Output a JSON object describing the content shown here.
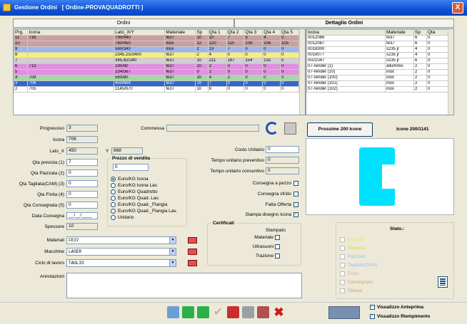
{
  "window": {
    "title": "Gestione Ordini",
    "subtitle": "[ Ordine-PROVAQUADROTTI ]",
    "close_glyph": "X"
  },
  "tabs": {
    "left": "Ordini",
    "right": "Dettaglio Ordini"
  },
  "left_table": {
    "headers": [
      "Prg.",
      "Icona",
      "Lato_X/Y",
      "Materiale",
      "Sp",
      "Qta 1",
      "Qta 2",
      "Qta 3",
      "Qta 4",
      "Qta 5"
    ],
    "rows": [
      {
        "bg": "#c9a0a0",
        "cells": [
          "11",
          "716",
          "790/440",
          "fe37",
          "10",
          "10",
          "7",
          "5",
          "4",
          "0"
        ]
      },
      {
        "bg": "#c9a0a0",
        "cells": [
          "10",
          "",
          "780/450",
          "inox",
          "12",
          "120",
          "110",
          "108",
          "106",
          "105"
        ]
      },
      {
        "bg": "#9db5ee",
        "cells": [
          "9",
          "",
          "560/340",
          "inox",
          "2",
          "13",
          "7",
          "0",
          "0",
          "0"
        ]
      },
      {
        "bg": "#f5f07c",
        "cells": [
          "8",
          "",
          "2345.25/3400",
          "fe37",
          "2",
          "4",
          "0",
          "0",
          "0",
          "0"
        ]
      },
      {
        "bg": "#d0d0d0",
        "cells": [
          "7",
          "",
          "345.82/240",
          "fe37",
          "10",
          "211",
          "187",
          "154",
          "132",
          "0"
        ]
      },
      {
        "bg": "#df90df",
        "cells": [
          "6",
          "713",
          "190/80",
          "fe37",
          "10",
          "2",
          "0",
          "0",
          "0",
          "0"
        ]
      },
      {
        "bg": "#df90df",
        "cells": [
          "5",
          "",
          "234/567",
          "fe37",
          "0",
          "2",
          "0",
          "0",
          "0",
          "0"
        ]
      },
      {
        "bg": "#a6d6a6",
        "cells": [
          "4",
          "709",
          "560/80",
          "fe37",
          "10",
          "4",
          "2",
          "0",
          "0",
          "0"
        ]
      },
      {
        "bg": "#3267cc",
        "fg": "#fff",
        "cells": [
          "3",
          "706",
          "450/668",
          "fe37",
          "10",
          "7",
          "0",
          "0",
          "0",
          "0"
        ]
      },
      {
        "bg": "#fff",
        "cells": [
          "2",
          "705",
          "1145/670",
          "fe37",
          "10",
          "6",
          "0",
          "0",
          "0",
          "0"
        ]
      }
    ]
  },
  "right_table": {
    "headers": [
      "Icona",
      "Materiale",
      "Sp",
      "Qta"
    ],
    "rows": [
      [
        "0012086",
        "fe37",
        "6",
        "0"
      ],
      [
        "0012087",
        "fe37",
        "6",
        "0"
      ],
      [
        "0018300",
        "s235 jr",
        "4",
        "0"
      ],
      [
        "0019077",
        "s235 jr",
        "4",
        "0"
      ],
      [
        "0021047",
        "s235 jr",
        "6",
        "0"
      ],
      [
        "07-render (1)",
        "alluminio",
        "2",
        "0"
      ],
      [
        "07-render (10)",
        "inox",
        "2",
        "0"
      ],
      [
        "07-render (100)",
        "inox",
        "2",
        "0"
      ],
      [
        "07-render (101)",
        "inox",
        "2",
        "0"
      ],
      [
        "07-render (102)",
        "inox",
        "2",
        "0"
      ]
    ]
  },
  "form": {
    "progressivo_label": "Progressivo",
    "progressivo": "3",
    "commessa_label": "Commessa",
    "commessa": "",
    "icona_label": "Icona",
    "icona": "706",
    "lato_x_label": "Lato_X",
    "lato_x": "450",
    "y_label": "Y",
    "y": "668",
    "costo_label": "Costo Unitario",
    "costo": "0",
    "qta_prevista_label": "Qta prevista (1)",
    "qta_prevista": "7",
    "qta_piazzata_label": "Qta Piazzata (2)",
    "qta_piazzata": "0",
    "qta_tagliata_label": "Qta Tagliata(CAM) (3)",
    "qta_tagliata": "0",
    "qta_finita_label": "Qta Finita (4)",
    "qta_finita": "0",
    "qta_consegnata_label": "Qta Consegnata (5)",
    "qta_consegnata": "0",
    "data_consegna_label": "Data Consegna",
    "data_consegna": "__/__/____",
    "spessore_label": "Spessore",
    "spessore": "10",
    "tempo_prev_label": "Tempo unitario preventivo",
    "tempo_prev": "0",
    "tempo_cons_label": "Tempo unitario consuntivo",
    "tempo_cons": "0",
    "consegna_pezzo_label": "Consegna a pezzo",
    "consegna_sfrido_label": "Consegna sfrido",
    "fatta_offerta_label": "Fatta Offerta",
    "stampa_disegno_label": "Stampa disegno Icona",
    "stampa_disegno_checked": "✓",
    "prezzo_title": "Prezzo di vendita",
    "prezzo": "0",
    "radios": [
      "Euro/KG Icona",
      "Euro/KG Icona Lav.",
      "Euro/KG Quadrotto",
      "Euro/KG Quad. Lav.",
      "Euro/KG Quad._Flangia",
      "Euro/KG Quad._Flangia Lav.",
      "Unitario"
    ],
    "certificati_title": "Certificati",
    "stampato_label": "Stampato",
    "materiale_cert_label": "Materiale",
    "ultrasuoni_label": "Ultrasuoni",
    "trazione_label": "Trazione",
    "materiali_label": "Materiali",
    "materiali": "FE37",
    "macchine_label": "Macchine",
    "macchine": "LASER",
    "ciclo_label": "Ciclo di lavoro",
    "ciclo": "TAGLIO",
    "annotazioni_label": "Annotazioni",
    "annotazioni": ""
  },
  "side": {
    "prossime_button": "Prossime 200 Icone",
    "counter": "Icone 200/1141"
  },
  "stato": {
    "title": "Stato.:",
    "items": [
      {
        "label": "Caricato",
        "color": "#f0e860"
      },
      {
        "label": "Sospeso",
        "color": "#e8d048"
      },
      {
        "label": "Piazzato",
        "color": "#88c8f0"
      },
      {
        "label": "Tagliato(CAM)",
        "color": "#a0b8f0"
      },
      {
        "label": "Finito",
        "color": "#c8b0b0"
      },
      {
        "label": "Consegnato",
        "color": "#e0a070"
      },
      {
        "label": "Chiuso",
        "color": "#f08080"
      }
    ]
  },
  "footer": {
    "anteprima_label": "Visualizzo Anteprima",
    "riempimento_label": "Visualizzo Riempimento",
    "anteprima_checked": "✓",
    "riempimento_checked": "✓"
  }
}
